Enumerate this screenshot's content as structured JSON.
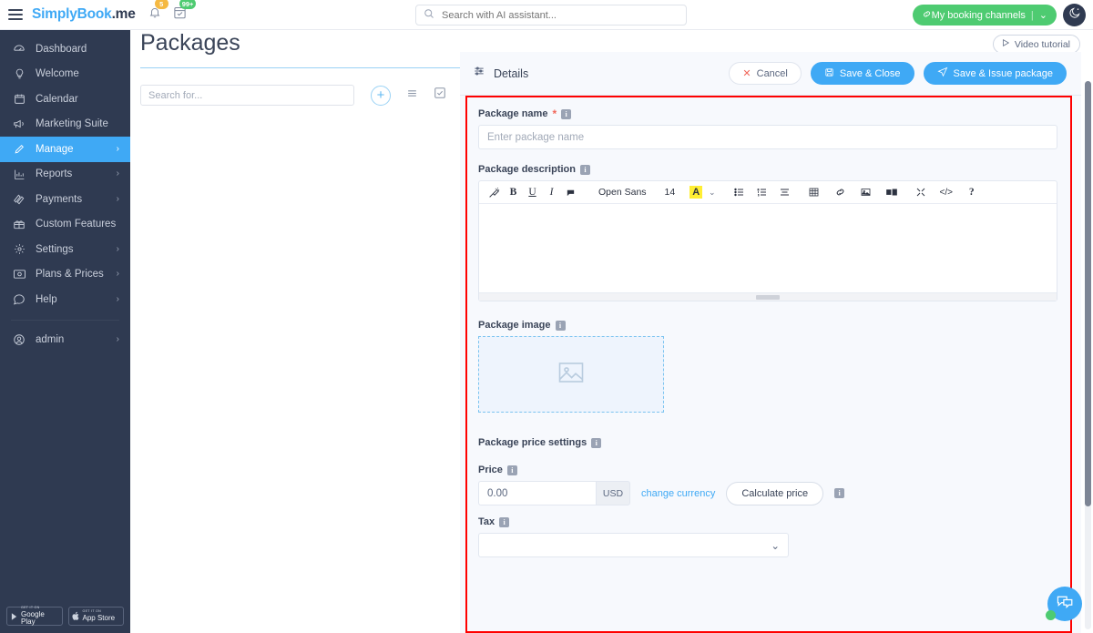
{
  "topbar": {
    "menu_icon": "hamburger-icon",
    "logo": {
      "part1": "S",
      "part2": "implyBook",
      "part3": ".me"
    },
    "bell_icon": "bell-icon",
    "bell_badge": "5",
    "calendar_icon": "calendar-check-icon",
    "calendar_badge": "99+",
    "search": {
      "placeholder": "Search with AI assistant...",
      "value": "",
      "icon": "search-icon"
    },
    "booking_channels": {
      "label": "My booking channels",
      "icon": "link-icon",
      "chevron": "⌄",
      "color": "#4ecb71"
    },
    "theme_toggle": {
      "icon": "moon-icon",
      "label": ""
    }
  },
  "sidebar": {
    "items": [
      {
        "label": "Dashboard",
        "icon": "dashboard-icon",
        "chevron": "",
        "active": false
      },
      {
        "label": "Welcome",
        "icon": "lightbulb-icon",
        "chevron": "",
        "active": false
      },
      {
        "label": "Calendar",
        "icon": "calendar-icon",
        "chevron": "",
        "active": false
      },
      {
        "label": "Marketing Suite",
        "icon": "megaphone-icon",
        "chevron": "",
        "active": false
      },
      {
        "label": "Manage",
        "icon": "pencil-icon",
        "chevron": "›",
        "active": true
      },
      {
        "label": "Reports",
        "icon": "bar-chart-icon",
        "chevron": "›",
        "active": false
      },
      {
        "label": "Payments",
        "icon": "payments-icon",
        "chevron": "›",
        "active": false
      },
      {
        "label": "Custom Features",
        "icon": "gift-icon",
        "chevron": "",
        "active": false
      },
      {
        "label": "Settings",
        "icon": "gear-icon",
        "chevron": "›",
        "active": false
      },
      {
        "label": "Plans & Prices",
        "icon": "money-icon",
        "chevron": "›",
        "active": false
      },
      {
        "label": "Help",
        "icon": "chat-icon",
        "chevron": "›",
        "active": false
      }
    ],
    "account": {
      "label": "admin",
      "icon": "user-icon",
      "chevron": "›"
    },
    "stores": [
      {
        "small": "GET IT ON",
        "big": "Google Play",
        "icon": "google-play-icon"
      },
      {
        "small": "GET IT ON",
        "big": "App Store",
        "icon": "apple-icon"
      }
    ]
  },
  "page": {
    "title": "Packages",
    "video_tutorial": {
      "label": "Video tutorial",
      "icon": "play-icon"
    },
    "toolbar": {
      "search_placeholder": "Search for...",
      "search_value": "",
      "add_label": "+",
      "list_icon": "list-icon",
      "checkbox_icon": "checkbox-icon"
    }
  },
  "panel": {
    "header": {
      "title": "Details",
      "icon": "sliders-icon"
    },
    "buttons": {
      "cancel": {
        "label": "Cancel",
        "icon": "x-icon"
      },
      "save_close": {
        "label": "Save & Close",
        "icon": "save-icon"
      },
      "save_issue": {
        "label": "Save & Issue package",
        "icon": "send-icon"
      }
    },
    "highlight_color": "#ff0000",
    "fields": {
      "package_name": {
        "label": "Package name",
        "required": "*",
        "info": "i",
        "placeholder": "Enter package name",
        "value": ""
      },
      "package_description": {
        "label": "Package description",
        "info": "i",
        "value": "",
        "editor": {
          "font_family": "Open Sans",
          "font_size": "14",
          "buttons": [
            {
              "name": "format-brush-icon",
              "glyph": "✨"
            },
            {
              "name": "bold-icon",
              "glyph": "B"
            },
            {
              "name": "underline-icon",
              "glyph": "U"
            },
            {
              "name": "italic-icon",
              "glyph": "I"
            },
            {
              "name": "highlight-icon",
              "glyph": "▰"
            },
            {
              "name": "font-family-select",
              "glyph": "Open Sans"
            },
            {
              "name": "font-size-select",
              "glyph": "14"
            },
            {
              "name": "text-color-icon",
              "glyph": "A"
            },
            {
              "name": "color-chevron-icon",
              "glyph": "⌄"
            },
            {
              "name": "bullet-list-icon",
              "glyph": "☰"
            },
            {
              "name": "numbered-list-icon",
              "glyph": "☷"
            },
            {
              "name": "align-icon",
              "glyph": "≡"
            },
            {
              "name": "table-icon",
              "glyph": "▦"
            },
            {
              "name": "link-icon",
              "glyph": "⛓"
            },
            {
              "name": "image-icon",
              "glyph": "▣"
            },
            {
              "name": "video-icon",
              "glyph": "▪▮"
            },
            {
              "name": "fullscreen-icon",
              "glyph": "⤢"
            },
            {
              "name": "source-code-icon",
              "glyph": "</>"
            },
            {
              "name": "help-icon",
              "glyph": "?"
            }
          ]
        }
      },
      "package_image": {
        "label": "Package image",
        "info": "i",
        "dropzone_icon": "image-placeholder-icon"
      },
      "package_price_settings": {
        "label": "Package price settings",
        "info": "i"
      },
      "price": {
        "label": "Price",
        "info": "i",
        "value": "0.00",
        "currency": "USD",
        "change_currency_link": "change currency",
        "calculate_button": "Calculate price",
        "calc_info": "i"
      },
      "tax": {
        "label": "Tax",
        "info": "i",
        "value": "",
        "chevron": "⌄"
      }
    }
  },
  "chat": {
    "icon": "chat-bubble-icon",
    "status": "online",
    "status_color": "#4ecb71"
  }
}
